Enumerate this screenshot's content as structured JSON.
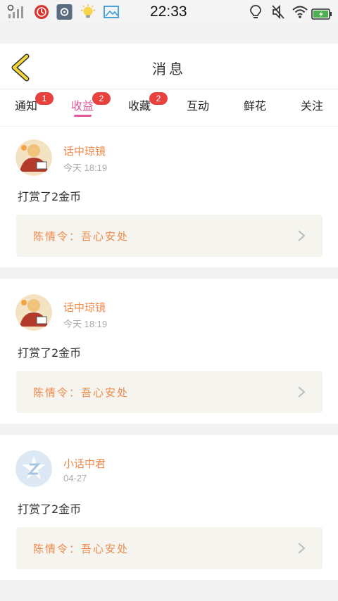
{
  "status_bar": {
    "time": "22:33",
    "battery_color": "#4caf50"
  },
  "header": {
    "title": "消息",
    "back_icon": "chevron-left-icon",
    "back_color": "#f5d63a"
  },
  "tabs": [
    {
      "label": "通知",
      "badge": "1",
      "active": false
    },
    {
      "label": "收益",
      "badge": "2",
      "active": true
    },
    {
      "label": "收藏",
      "badge": "2",
      "active": false
    },
    {
      "label": "互动",
      "badge": "",
      "active": false
    },
    {
      "label": "鲜花",
      "badge": "",
      "active": false
    },
    {
      "label": "关注",
      "badge": "",
      "active": false
    }
  ],
  "colors": {
    "accent": "#e05a9b",
    "badge": "#e8423f",
    "username": "#f08a4a"
  },
  "messages": [
    {
      "user": "话中琼镜",
      "time": "今天 18:19",
      "action": "打赏了2金币",
      "work": "陈情令：吾心安处",
      "avatar": "user-avatar"
    },
    {
      "user": "话中琼镜",
      "time": "今天 18:19",
      "action": "打赏了2金币",
      "work": "陈情令：吾心安处",
      "avatar": "user-avatar"
    },
    {
      "user": "小话中君",
      "time": "04-27",
      "action": "打赏了2金币",
      "work": "陈情令：吾心安处",
      "avatar": "default-avatar"
    }
  ]
}
